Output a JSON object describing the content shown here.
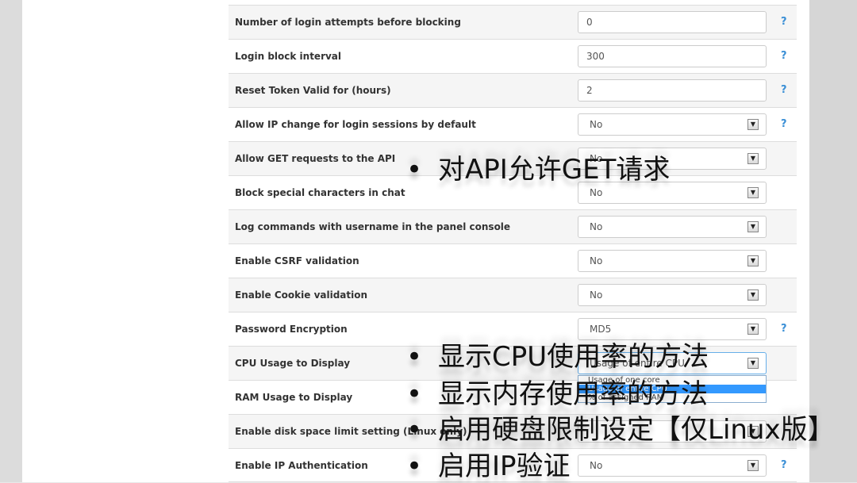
{
  "settings": [
    {
      "label": "Number of login attempts before blocking",
      "type": "text",
      "value": "0",
      "help": "?"
    },
    {
      "label": "Login block interval",
      "type": "text",
      "value": "300",
      "help": "?"
    },
    {
      "label": "Reset Token Valid for (hours)",
      "type": "text",
      "value": "2",
      "help": "?"
    },
    {
      "label": "Allow IP change for login sessions by default",
      "type": "select",
      "value": "No",
      "help": "?"
    },
    {
      "label": "Allow GET requests to the API",
      "type": "select",
      "value": "No",
      "help": ""
    },
    {
      "label": "Block special characters in chat",
      "type": "select",
      "value": "No",
      "help": ""
    },
    {
      "label": "Log commands with username in the panel console",
      "type": "select",
      "value": "No",
      "help": ""
    },
    {
      "label": "Enable CSRF validation",
      "type": "select",
      "value": "No",
      "help": ""
    },
    {
      "label": "Enable Cookie validation",
      "type": "select",
      "value": "No",
      "help": ""
    },
    {
      "label": "Password Encryption",
      "type": "select",
      "value": "MD5",
      "help": "?"
    },
    {
      "label": "CPU Usage to Display",
      "type": "select",
      "value": "Usage of entire CPU",
      "help": "",
      "open": true
    },
    {
      "label": "RAM Usage to Display",
      "type": "select",
      "value": "",
      "help": ""
    },
    {
      "label": "Enable disk space limit setting (Linux only)",
      "type": "select",
      "value": "",
      "help": ""
    },
    {
      "label": "Enable IP Authentication",
      "type": "select",
      "value": "No",
      "help": "?"
    }
  ],
  "cpu_dropdown": {
    "options": [
      "Usage of one core",
      "Usage of entire CPU",
      "% of assigned RAM"
    ],
    "selected_index": 1
  },
  "captions": [
    "对API允许GET请求",
    "显示CPU使用率的方法",
    "显示内存使用率的方法",
    "启用硬盘限制设定【仅Linux版】",
    "启用IP验证"
  ],
  "colors": {
    "help_icon": "#3a8fd6",
    "selected_option": "#3399ff"
  }
}
